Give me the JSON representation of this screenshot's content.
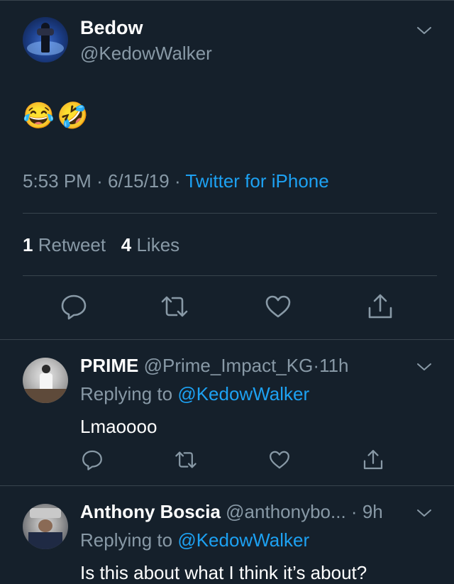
{
  "tweet": {
    "name": "Bedow",
    "handle": "@KedowWalker",
    "emoji_1": "😂",
    "emoji_2": "🤣",
    "time": "5:53 PM",
    "date": "6/15/19",
    "dot": "·",
    "source": "Twitter for iPhone",
    "retweet_count": "1",
    "retweet_label": "Retweet",
    "like_count": "4",
    "like_label": "Likes"
  },
  "replies": [
    {
      "name": "PRIME",
      "handle": "@Prime_Impact_KG",
      "time": "11h",
      "replying_prefix": "Replying to",
      "replying_to": "@KedowWalker",
      "text": "Lmaoooo"
    },
    {
      "name": "Anthony Boscia",
      "handle": "@anthonybo...",
      "time": "9h",
      "replying_prefix": "Replying to",
      "replying_to": "@KedowWalker",
      "text": "Is this about what I think it’s about?"
    }
  ],
  "icons": [
    "chevron-down-icon",
    "reply-icon",
    "retweet-icon",
    "like-icon",
    "share-icon"
  ],
  "colors": {
    "background": "#15202b",
    "accent": "#1da1f2",
    "secondary_text": "#8899a6",
    "divider": "#38444d"
  }
}
